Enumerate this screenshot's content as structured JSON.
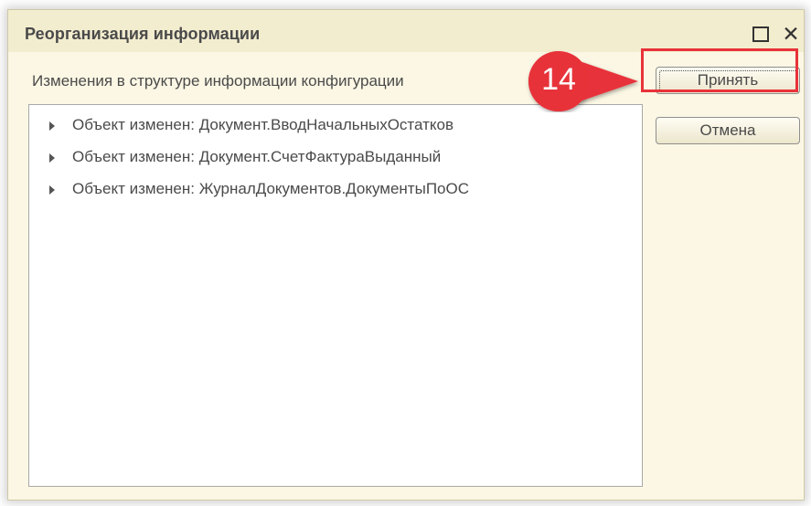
{
  "window": {
    "title": "Реорганизация информации",
    "maximize_icon": "maximize-icon",
    "close_icon": "close-icon",
    "close_glyph": "✕"
  },
  "subtitle": "Изменения в структуре информации конфигурации",
  "tree": {
    "items": [
      {
        "label": "Объект изменен: Документ.ВводНачальныхОстатков"
      },
      {
        "label": "Объект изменен: Документ.СчетФактураВыданный"
      },
      {
        "label": "Объект изменен: ЖурналДокументов.ДокументыПоОС"
      }
    ]
  },
  "buttons": {
    "accept_label": "Принять",
    "cancel_label": "Отмена"
  },
  "annotation": {
    "step_number": "14",
    "color": "#e8323a"
  },
  "colors": {
    "dialog_background": "#fbf7e4",
    "titlebar_background": "#f3edcf",
    "highlight": "#e8323a"
  }
}
